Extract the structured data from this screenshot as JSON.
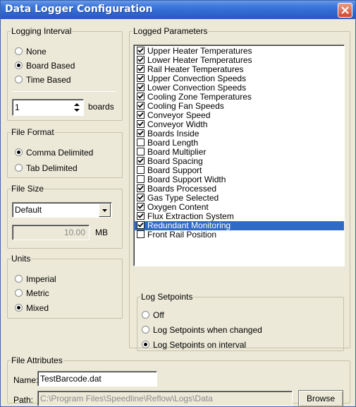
{
  "window": {
    "title": "Data Logger Configuration"
  },
  "logging_interval": {
    "legend": "Logging Interval",
    "options": [
      {
        "label": "None",
        "selected": false
      },
      {
        "label": "Board Based",
        "selected": true
      },
      {
        "label": "Time Based",
        "selected": false
      }
    ],
    "value": "1",
    "unit_label": "boards"
  },
  "file_format": {
    "legend": "File Format",
    "options": [
      {
        "label": "Comma Delimited",
        "selected": true
      },
      {
        "label": "Tab Delimited",
        "selected": false
      }
    ]
  },
  "file_size": {
    "legend": "File Size",
    "selected": "Default",
    "size_value": "10.00",
    "unit_label": "MB"
  },
  "units": {
    "legend": "Units",
    "options": [
      {
        "label": "Imperial",
        "selected": false
      },
      {
        "label": "Metric",
        "selected": false
      },
      {
        "label": "Mixed",
        "selected": true
      }
    ]
  },
  "logged_parameters": {
    "legend": "Logged Parameters",
    "items": [
      {
        "label": "Upper Heater Temperatures",
        "checked": true,
        "highlighted": false
      },
      {
        "label": "Lower Heater Temperatures",
        "checked": true,
        "highlighted": false
      },
      {
        "label": "Rail Heater Temperatures",
        "checked": true,
        "highlighted": false
      },
      {
        "label": "Upper Convection Speeds",
        "checked": true,
        "highlighted": false
      },
      {
        "label": "Lower Convection Speeds",
        "checked": true,
        "highlighted": false
      },
      {
        "label": "Cooling Zone Temperatures",
        "checked": true,
        "highlighted": false
      },
      {
        "label": "Cooling Fan Speeds",
        "checked": true,
        "highlighted": false
      },
      {
        "label": "Conveyor Speed",
        "checked": true,
        "highlighted": false
      },
      {
        "label": "Conveyor Width",
        "checked": true,
        "highlighted": false
      },
      {
        "label": "Boards Inside",
        "checked": true,
        "highlighted": false
      },
      {
        "label": "Board Length",
        "checked": false,
        "highlighted": false
      },
      {
        "label": "Board Multiplier",
        "checked": false,
        "highlighted": false
      },
      {
        "label": "Board Spacing",
        "checked": true,
        "highlighted": false
      },
      {
        "label": "Board Support",
        "checked": false,
        "highlighted": false
      },
      {
        "label": "Board Support Width",
        "checked": false,
        "highlighted": false
      },
      {
        "label": "Boards Processed",
        "checked": true,
        "highlighted": false
      },
      {
        "label": "Gas Type Selected",
        "checked": true,
        "highlighted": false
      },
      {
        "label": "Oxygen Content",
        "checked": true,
        "highlighted": false
      },
      {
        "label": "Flux Extraction System",
        "checked": true,
        "highlighted": false
      },
      {
        "label": "Redundant Monitoring",
        "checked": true,
        "highlighted": true
      },
      {
        "label": "Front Rail Position",
        "checked": false,
        "highlighted": false
      }
    ]
  },
  "log_setpoints": {
    "legend": "Log Setpoints",
    "options": [
      {
        "label": "Off",
        "selected": false
      },
      {
        "label": "Log Setpoints when changed",
        "selected": false
      },
      {
        "label": "Log Setpoints on interval",
        "selected": true
      }
    ]
  },
  "file_attributes": {
    "legend": "File Attributes",
    "name_label": "Name:",
    "name_value": "TestBarcode.dat",
    "path_label": "Path:",
    "path_value": "C:\\Program Files\\Speedline\\Reflow\\Logs\\Data",
    "browse_label": "Browse"
  },
  "colors": {
    "title_bar": "#2f64cf",
    "dialog_bg": "#ece9d8",
    "selection": "#316ac5",
    "close_button": "#d5472b"
  }
}
